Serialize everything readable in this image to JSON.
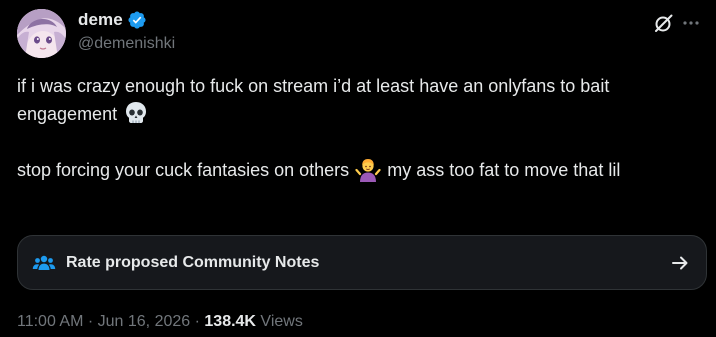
{
  "author": {
    "display_name": "deme",
    "handle": "@demenishki",
    "verified": true,
    "avatar_icon": "anime-avatar"
  },
  "header_actions": {
    "grok_icon": "grok-icon",
    "more_icon": "more-options-icon"
  },
  "tweet": {
    "line1_text": "if i was crazy enough to fuck on stream i’d at least have an onlyfans to bait engagement",
    "line1_emoji": "skull-emoji",
    "line2_text_before": "stop forcing your cuck fantasies on others",
    "line2_emoji": "person-shrugging-emoji",
    "line2_text_after": "my ass too fat to move that lil"
  },
  "community_notes": {
    "label": "Rate proposed Community Notes",
    "icon": "people-icon",
    "arrow_icon": "arrow-right-icon"
  },
  "meta": {
    "time": "11:00 AM",
    "separator1": " · ",
    "date": "Jun 16, 2026",
    "separator2": " · ",
    "views_count": "138.4K",
    "views_label": " Views"
  },
  "colors": {
    "background": "#000000",
    "text_primary": "#e7e9ea",
    "text_secondary": "#71767b",
    "verified_blue": "#1d9bf0",
    "card_border": "#2f3336"
  }
}
